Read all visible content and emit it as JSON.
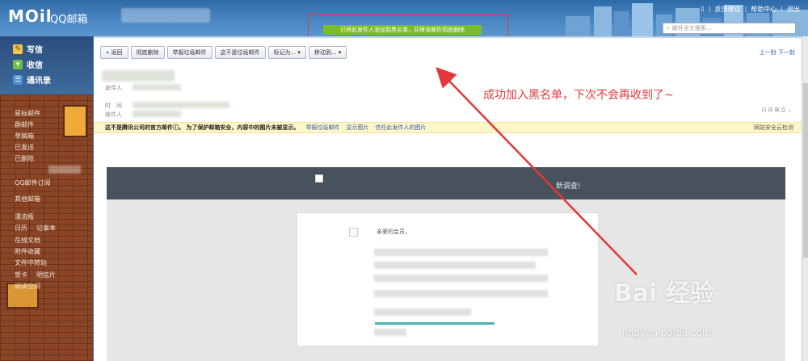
{
  "header": {
    "logo": "MOil",
    "logo_sub": "QQ邮箱",
    "links": [
      "反馈建议",
      "帮助中心",
      "退出"
    ],
    "search_placeholder": "邮件全文搜索..."
  },
  "notice": "已将此发件人添加到黑名单，并将该邮件彻底删除",
  "sidebar": {
    "quick": [
      "写信",
      "收信",
      "通讯录"
    ],
    "items": [
      "星标邮件",
      "群邮件",
      "草稿箱",
      "已发送",
      "已删除",
      "QQ邮件订阅",
      "其他邮箱",
      "漂流瓶",
      "日历",
      "记事本",
      "在线文档",
      "附件收藏",
      "文件中转站",
      "贺卡",
      "明信片",
      "阅读空间"
    ]
  },
  "toolbar": {
    "buttons": [
      "« 返回",
      "彻底删除",
      "举报垃圾邮件",
      "这不是垃圾邮件",
      "标记为...",
      "移动到..."
    ],
    "nav": "上一封  下一封"
  },
  "meta": {
    "from_label": "发件人",
    "time_label": "时　间",
    "to_label": "收件人"
  },
  "warning": {
    "text": "这不是腾讯公司的官方邮件",
    "text2": "。  为了保护邮箱安全，内容中的图片未被显示。",
    "links": [
      "举报垃圾邮件",
      "显示图片",
      "信任此发件人的图片"
    ],
    "right": "网站安全云检测"
  },
  "mail": {
    "title": "新调查!",
    "greeting": "亲爱的会员，"
  },
  "annotation": "成功加入黑名单，下次不会再收到了~",
  "watermark": {
    "brand": "Bai 经验",
    "url": "jingyan.baidu.com"
  },
  "colors": {
    "header_blue": "#3b6fa8",
    "notice_green": "#7cbb2e",
    "annotation_red": "#e2383a",
    "warning_bg": "#fff6c8"
  }
}
